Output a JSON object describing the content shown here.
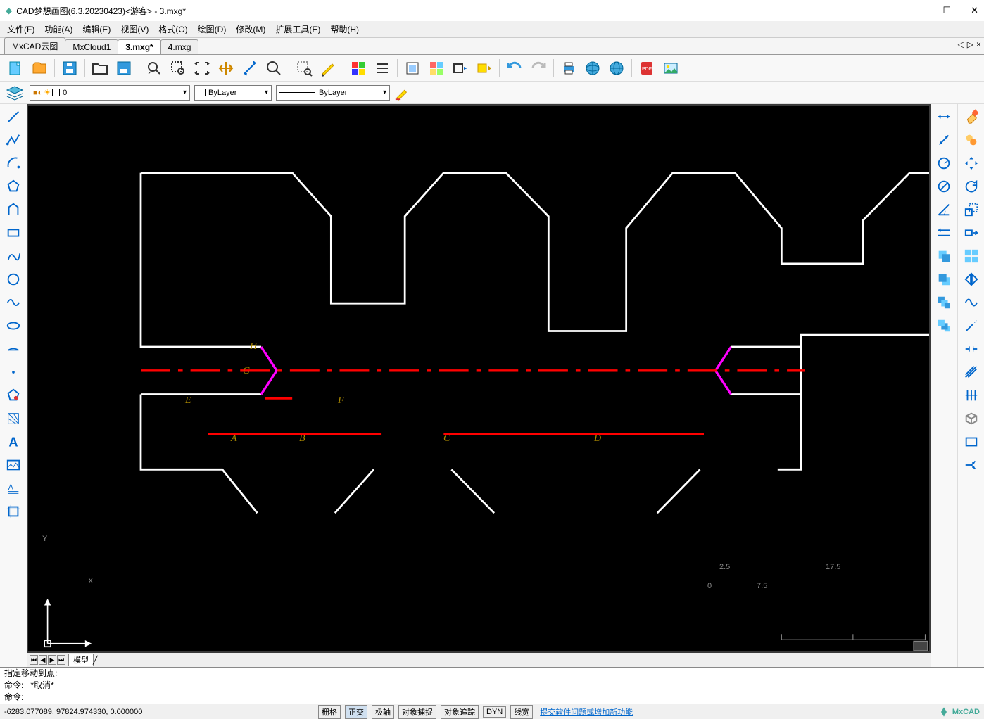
{
  "window": {
    "title": "CAD梦想画图(6.3.20230423)<游客> - 3.mxg*"
  },
  "menu": [
    "文件(F)",
    "功能(A)",
    "编辑(E)",
    "视图(V)",
    "格式(O)",
    "绘图(D)",
    "修改(M)",
    "扩展工具(E)",
    "帮助(H)"
  ],
  "tabs": [
    {
      "label": "MxCAD云图",
      "active": false
    },
    {
      "label": "MxCloud1",
      "active": false
    },
    {
      "label": "3.mxg*",
      "active": true
    },
    {
      "label": "4.mxg",
      "active": false
    }
  ],
  "layer_dd": "0",
  "layer_dd_prefix_icons": "■◐ ☀ □",
  "color_dd": "ByLayer",
  "linetype_dd": "ByLayer",
  "modeltab": "模型",
  "cmd": {
    "history1": "指定移动到点:",
    "history2": "命令:   *取消*",
    "prompt": "命令:"
  },
  "status": {
    "coords": "-6283.077089,   97824.974330,   0.000000",
    "buttons": [
      "栅格",
      "正交",
      "极轴",
      "对象捕捉",
      "对象追踪",
      "DYN",
      "线宽"
    ],
    "link": "提交软件问题或增加新功能",
    "brand": "MxCAD"
  },
  "canvas_labels": {
    "A": "A",
    "B": "B",
    "C": "C",
    "D": "D",
    "E": "E",
    "F": "F",
    "G": "G",
    "H": "H",
    "X": "X",
    "Y": "Y"
  },
  "scale": {
    "left": "2.5",
    "right": "17.5",
    "b0": "0",
    "bm": "7.5"
  },
  "toolbar_icons": [
    "new",
    "open-folder",
    "save",
    "folder",
    "save-arr",
    "zoom-win",
    "zoom-rect",
    "zoom-ext",
    "pan",
    "measure",
    "zoom",
    "sel-rect",
    "pencil",
    "color-grid",
    "list",
    "layer-box",
    "props",
    "move-rect",
    "highlight",
    "undo",
    "redo",
    "print",
    "globe1",
    "globe2",
    "pdf",
    "image"
  ],
  "left_tools": [
    "line",
    "polyline",
    "arc",
    "polygon",
    "poly-open",
    "rect",
    "spline1",
    "circle",
    "spline2",
    "ellipse",
    "revcloud",
    "point",
    "hatch",
    "region",
    "text",
    "image-l",
    "mtext",
    "crop"
  ],
  "right_tools1": [
    "dim-linear",
    "dim-aligned",
    "dim-radius",
    "dim-diameter",
    "dim-angle",
    "dim-horiz",
    "mirror-h",
    "mirror-v",
    "array",
    "copy-arr"
  ],
  "right_tools2": [
    "erase",
    "copy",
    "move",
    "rotate",
    "scale",
    "stretch",
    "trim",
    "extend",
    "fillet",
    "chamfer",
    "break",
    "explode",
    "offset-line",
    "offset",
    "wave",
    "dash",
    "parallel",
    "box3d",
    "rect-tool",
    "arrow-split"
  ]
}
